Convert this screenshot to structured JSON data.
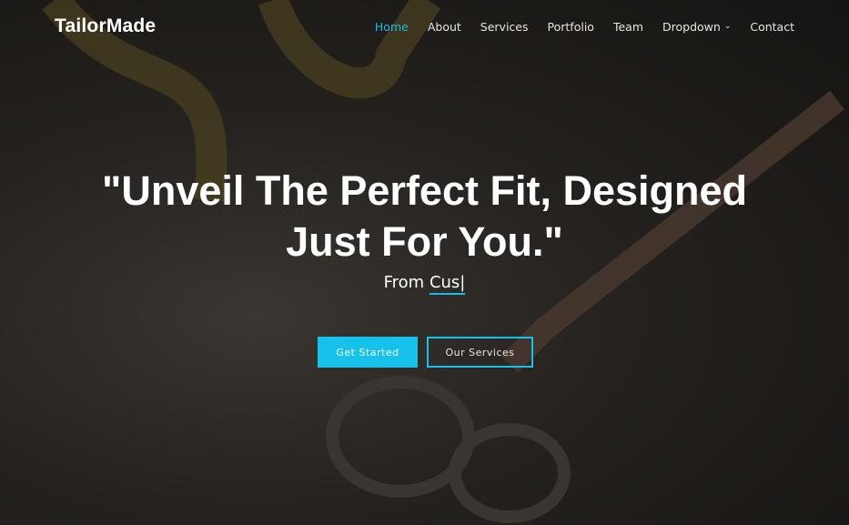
{
  "brand": "TailorMade",
  "nav": [
    {
      "label": "Home",
      "active": true
    },
    {
      "label": "About"
    },
    {
      "label": "Services"
    },
    {
      "label": "Portfolio"
    },
    {
      "label": "Team"
    },
    {
      "label": "Dropdown",
      "icon": "chevron-down-icon"
    },
    {
      "label": "Contact"
    }
  ],
  "hero": {
    "title_line1": "\"Unveil The Perfect Fit, Designed",
    "title_line2": "Just For You.\"",
    "sub_prefix": "From ",
    "sub_typed": "Cus|"
  },
  "buttons": {
    "primary": "Get Started",
    "secondary": "Our Services"
  },
  "colors": {
    "accent": "#1bbde8"
  }
}
